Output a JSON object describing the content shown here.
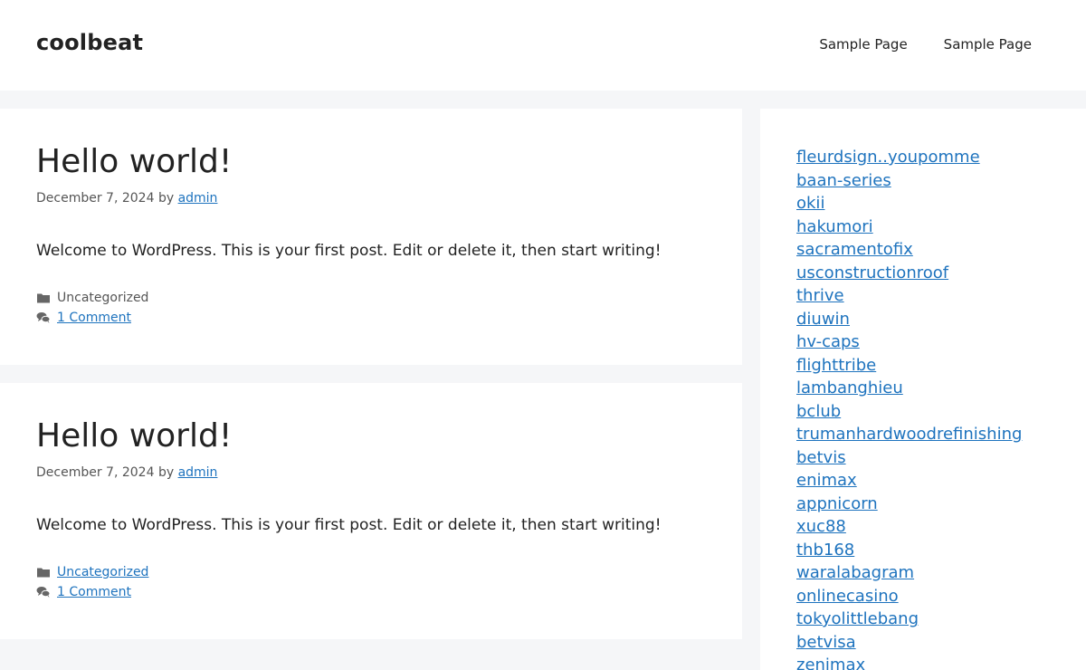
{
  "site": {
    "title": "coolbeat"
  },
  "nav": {
    "items": [
      "Sample Page",
      "Sample Page"
    ]
  },
  "posts": [
    {
      "title": "Hello world!",
      "date": "December 7, 2024",
      "by": "by",
      "author": "admin",
      "excerpt": "Welcome to WordPress. This is your first post. Edit or delete it, then start writing!",
      "category": "Uncategorized",
      "comments": "1 Comment"
    },
    {
      "title": "Hello world!",
      "date": "December 7, 2024",
      "by": "by",
      "author": "admin",
      "excerpt": "Welcome to WordPress. This is your first post. Edit or delete it, then start writing!",
      "category": "Uncategorized",
      "comments": "1 Comment"
    }
  ],
  "sidebar": {
    "links": [
      "fleurdsign..youpomme",
      "baan-series",
      "okii",
      "hakumori",
      "sacramentofix",
      "usconstructionroof",
      "thrive",
      "diuwin",
      "hv-caps",
      "flighttribe",
      "lambanghieu",
      "bclub",
      "trumanhardwoodrefinishing",
      "betvis",
      "enimax",
      "appnicorn",
      "xuc88",
      "thb168",
      "waralabagram",
      "onlinecasino",
      "tokyolittlebang",
      "betvisa",
      "zenimax"
    ]
  },
  "icons": {
    "category": "folder-icon",
    "comments": "comments-icon"
  },
  "colors": {
    "link": "#1e73be",
    "background": "#f5f6f8",
    "text": "#222222"
  }
}
